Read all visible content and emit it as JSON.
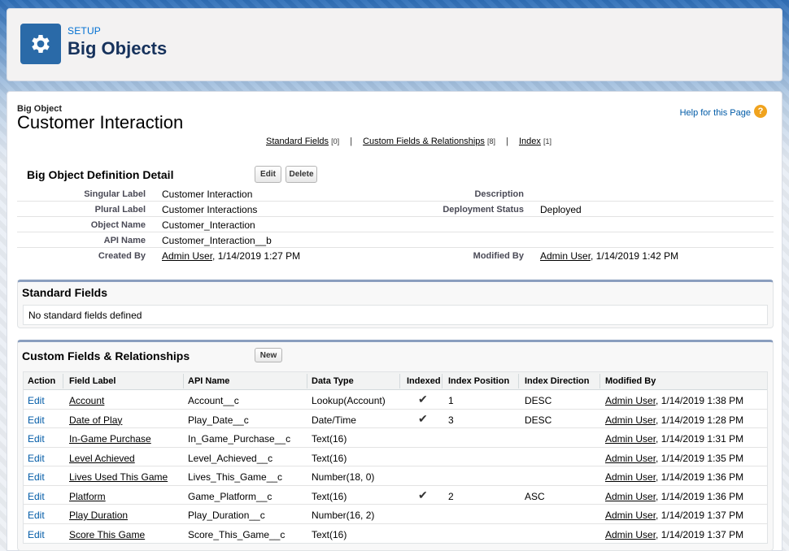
{
  "header": {
    "setup_label": "SETUP",
    "title": "Big Objects",
    "icon": "gear-icon"
  },
  "record": {
    "type_label": "Big Object",
    "title": "Customer Interaction",
    "help_link": "Help for this Page"
  },
  "related_links": [
    {
      "label": "Standard Fields",
      "count": "[0]"
    },
    {
      "label": "Custom Fields & Relationships",
      "count": "[8]"
    },
    {
      "label": "Index",
      "count": "[1]"
    }
  ],
  "separator": "|",
  "detail": {
    "title": "Big Object Definition Detail",
    "edit_label": "Edit",
    "delete_label": "Delete",
    "singular_label_label": "Singular Label",
    "singular_label": "Customer Interaction",
    "plural_label_label": "Plural Label",
    "plural_label": "Customer Interactions",
    "object_name_label": "Object Name",
    "object_name": "Customer_Interaction",
    "api_name_label": "API Name",
    "api_name": "Customer_Interaction__b",
    "created_by_label": "Created By",
    "created_by_user": "Admin User",
    "created_by_date": ", 1/14/2019 1:27 PM",
    "description_label": "Description",
    "description": "",
    "deployment_status_label": "Deployment Status",
    "deployment_status": "Deployed",
    "modified_by_label": "Modified By",
    "modified_by_user": "Admin User",
    "modified_by_date": ", 1/14/2019 1:42 PM"
  },
  "standard_fields": {
    "title": "Standard Fields",
    "empty_text": "No standard fields defined"
  },
  "custom_fields": {
    "title": "Custom Fields & Relationships",
    "new_label": "New",
    "columns": [
      "Action",
      "Field Label",
      "API Name",
      "Data Type",
      "Indexed",
      "Index Position",
      "Index Direction",
      "Modified By"
    ],
    "rows": [
      {
        "action": "Edit",
        "label": "Account",
        "api": "Account__c",
        "type": "Lookup(Account)",
        "indexed": "✔",
        "position": "1",
        "direction": "DESC",
        "user": "Admin User",
        "date": ", 1/14/2019 1:38 PM"
      },
      {
        "action": "Edit",
        "label": "Date of Play",
        "api": "Play_Date__c",
        "type": "Date/Time",
        "indexed": "✔",
        "position": "3",
        "direction": "DESC",
        "user": "Admin User",
        "date": ", 1/14/2019 1:28 PM"
      },
      {
        "action": "Edit",
        "label": "In-Game Purchase",
        "api": "In_Game_Purchase__c",
        "type": "Text(16)",
        "indexed": "",
        "position": "",
        "direction": "",
        "user": "Admin User",
        "date": ", 1/14/2019 1:31 PM"
      },
      {
        "action": "Edit",
        "label": "Level Achieved",
        "api": "Level_Achieved__c",
        "type": "Text(16)",
        "indexed": "",
        "position": "",
        "direction": "",
        "user": "Admin User",
        "date": ", 1/14/2019 1:35 PM"
      },
      {
        "action": "Edit",
        "label": "Lives Used This Game",
        "api": "Lives_This_Game__c",
        "type": "Number(18, 0)",
        "indexed": "",
        "position": "",
        "direction": "",
        "user": "Admin User",
        "date": ", 1/14/2019 1:36 PM"
      },
      {
        "action": "Edit",
        "label": "Platform",
        "api": "Game_Platform__c",
        "type": "Text(16)",
        "indexed": "✔",
        "position": "2",
        "direction": "ASC",
        "user": "Admin User",
        "date": ", 1/14/2019 1:36 PM"
      },
      {
        "action": "Edit",
        "label": "Play Duration",
        "api": "Play_Duration__c",
        "type": "Number(16, 2)",
        "indexed": "",
        "position": "",
        "direction": "",
        "user": "Admin User",
        "date": ", 1/14/2019 1:37 PM"
      },
      {
        "action": "Edit",
        "label": "Score This Game",
        "api": "Score_This_Game__c",
        "type": "Text(16)",
        "indexed": "",
        "position": "",
        "direction": "",
        "user": "Admin User",
        "date": ", 1/14/2019 1:37 PM"
      }
    ]
  }
}
